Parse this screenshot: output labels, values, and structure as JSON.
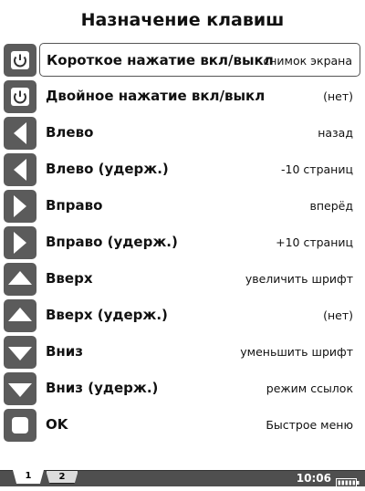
{
  "title": "Назначение клавиш",
  "rows": [
    {
      "icon": "power-icon",
      "label": "Короткое нажатие вкл/выкл",
      "value": "снимок экрана",
      "selected": true
    },
    {
      "icon": "power-icon",
      "label": "Двойное нажатие вкл/выкл",
      "value": "(нет)"
    },
    {
      "icon": "arrow-left-icon",
      "label": "Влево",
      "value": "назад"
    },
    {
      "icon": "arrow-left-icon",
      "label": "Влево (удерж.)",
      "value": "-10 страниц"
    },
    {
      "icon": "arrow-right-icon",
      "label": "Вправо",
      "value": "вперёд"
    },
    {
      "icon": "arrow-right-icon",
      "label": "Вправо (удерж.)",
      "value": "+10 страниц"
    },
    {
      "icon": "arrow-up-icon",
      "label": "Вверх",
      "value": "увеличить шрифт"
    },
    {
      "icon": "arrow-up-icon",
      "label": "Вверх (удерж.)",
      "value": "(нет)"
    },
    {
      "icon": "arrow-down-icon",
      "label": "Вниз",
      "value": "уменьшить шрифт"
    },
    {
      "icon": "arrow-down-icon",
      "label": "Вниз (удерж.)",
      "value": "режим ссылок"
    },
    {
      "icon": "ok-square-icon",
      "label": "OK",
      "value": "Быстрое меню"
    }
  ],
  "statusbar": {
    "tabs": [
      "1",
      "2"
    ],
    "active_tab": "1",
    "time": "10:06",
    "battery_icon": "battery-icon"
  }
}
